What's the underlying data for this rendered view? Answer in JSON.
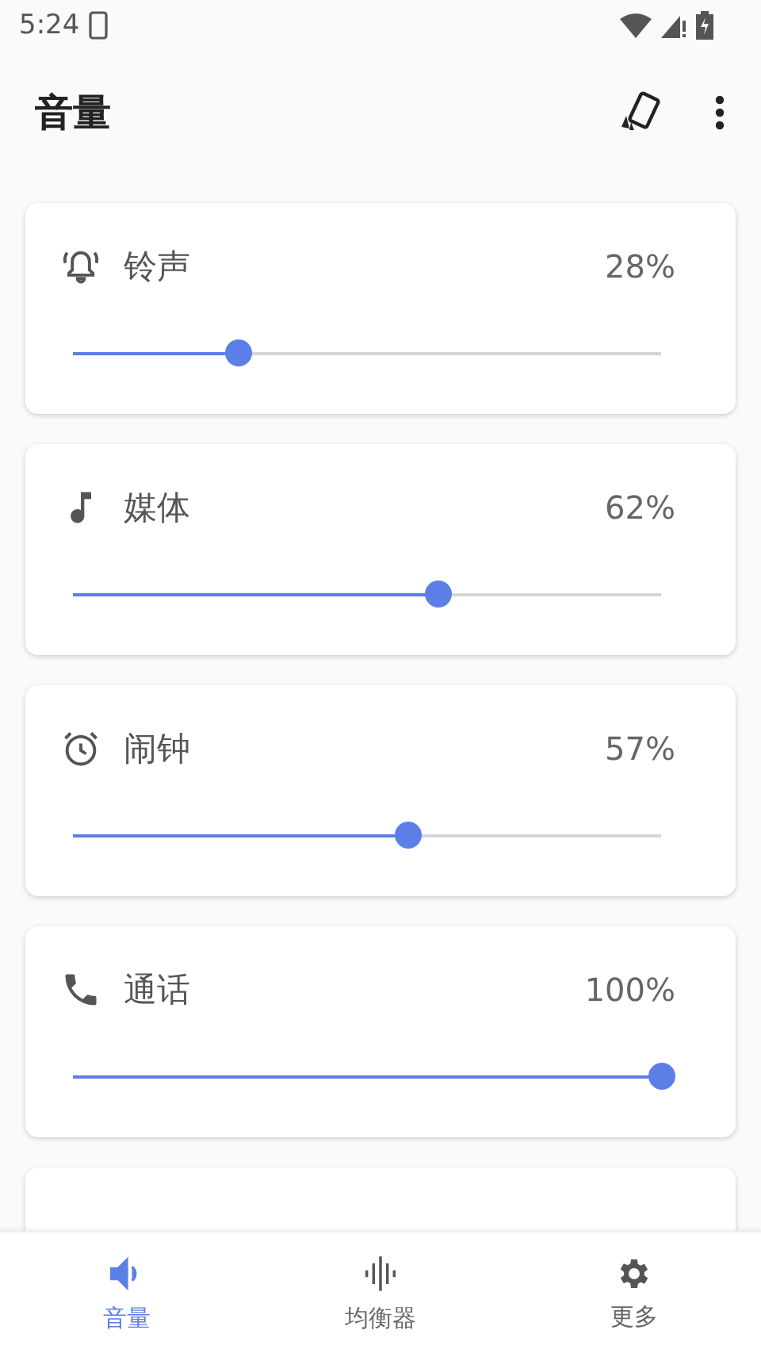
{
  "status_bar": {
    "time": "5:24"
  },
  "app_bar": {
    "title": "音量"
  },
  "channels": [
    {
      "kind": "ring",
      "name": "铃声",
      "reading": "28%",
      "level": 0.28
    },
    {
      "kind": "media",
      "name": "媒体",
      "reading": "62%",
      "level": 0.62
    },
    {
      "kind": "alarm",
      "name": "闹钟",
      "reading": "57%",
      "level": 0.57
    },
    {
      "kind": "call",
      "name": "通话",
      "reading": "100%",
      "level": 1.0
    }
  ],
  "bottom_nav": [
    {
      "kind": "volume",
      "label": "音量",
      "selected": true
    },
    {
      "kind": "equalizer",
      "label": "均衡器",
      "selected": false
    },
    {
      "kind": "more",
      "label": "更多",
      "selected": false
    }
  ]
}
